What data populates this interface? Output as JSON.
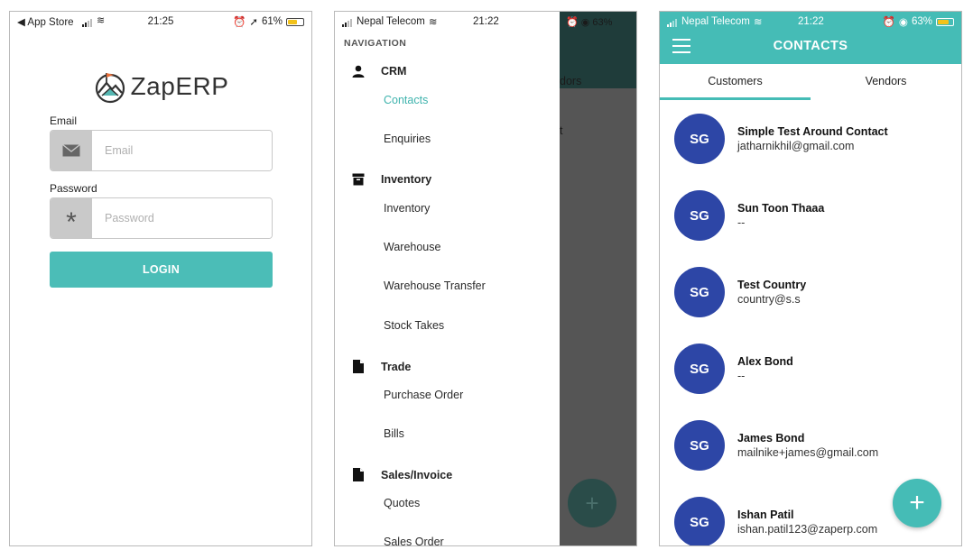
{
  "login_screen": {
    "status": {
      "left": "◀ App Store",
      "time": "21:25",
      "right": "61%"
    },
    "app_name": "ZapERP",
    "email_label": "Email",
    "email_placeholder": "Email",
    "password_label": "Password",
    "password_placeholder": "Password",
    "login_button": "LOGIN"
  },
  "nav_screen": {
    "status": {
      "carrier": "Nepal Telecom",
      "time": "21:22",
      "right": "63%"
    },
    "heading": "NAVIGATION",
    "background_texts": [
      "dors",
      "t"
    ],
    "sections": [
      {
        "title": "CRM",
        "icon": "person-icon",
        "items": [
          "Contacts",
          "Enquiries"
        ]
      },
      {
        "title": "Inventory",
        "icon": "archive-box-icon",
        "items": [
          "Inventory",
          "Warehouse",
          "Warehouse Transfer",
          "Stock Takes"
        ]
      },
      {
        "title": "Trade",
        "icon": "document-icon",
        "items": [
          "Purchase Order",
          "Bills"
        ]
      },
      {
        "title": "Sales/Invoice",
        "icon": "document-icon",
        "items": [
          "Quotes",
          "Sales Order"
        ]
      }
    ],
    "active_item": "Contacts"
  },
  "contacts_screen": {
    "status": {
      "carrier": "Nepal Telecom",
      "time": "21:22",
      "right": "63%"
    },
    "title": "CONTACTS",
    "tabs": [
      "Customers",
      "Vendors"
    ],
    "selected_tab": "Customers",
    "contacts": [
      {
        "initials": "SG",
        "name": "Simple Test Around Contact",
        "email": "jatharnikhil@gmail.com"
      },
      {
        "initials": "SG",
        "name": "Sun Toon Thaaa",
        "email": "--"
      },
      {
        "initials": "SG",
        "name": "Test Country",
        "email": "country@s.s"
      },
      {
        "initials": "SG",
        "name": "Alex Bond",
        "email": "--"
      },
      {
        "initials": "SG",
        "name": "James Bond",
        "email": "mailnike+james@gmail.com"
      },
      {
        "initials": "SG",
        "name": "Ishan Patil",
        "email": "ishan.patil123@zaperp.com"
      }
    ],
    "fab_label": "+"
  },
  "colors": {
    "accent": "#45bcb6",
    "avatar": "#2d46a6",
    "login_button": "#4bbdb7"
  }
}
